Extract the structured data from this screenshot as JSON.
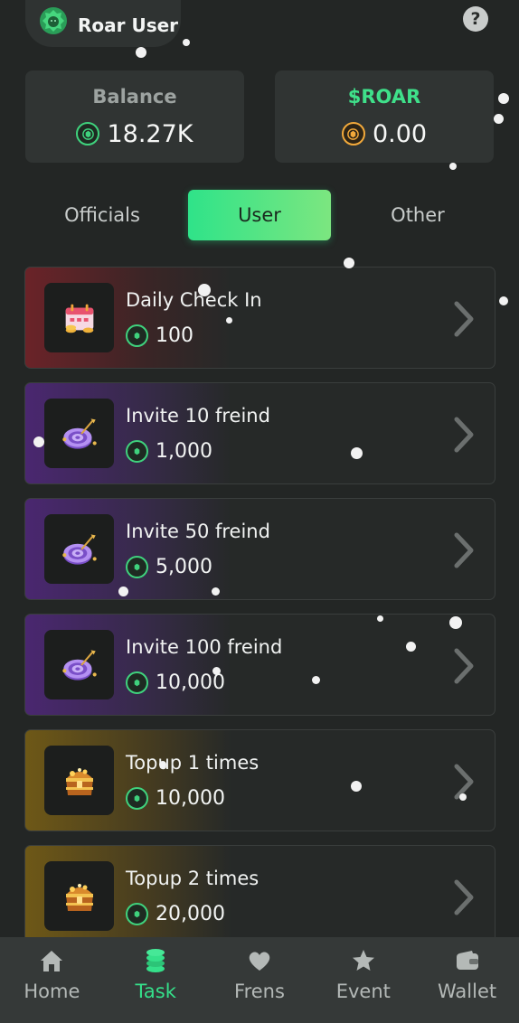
{
  "header": {
    "user_name": "Roar User",
    "help_label": "?"
  },
  "stats": {
    "balance": {
      "label": "Balance",
      "value": "18.27K"
    },
    "roar": {
      "label": "$ROAR",
      "value": "0.00"
    }
  },
  "tabs": [
    {
      "label": "Officials",
      "active": false
    },
    {
      "label": "User",
      "active": true
    },
    {
      "label": "Other",
      "active": false
    }
  ],
  "tasks": [
    {
      "title": "Daily Check In",
      "reward": "100",
      "icon": "calendar-gift-icon",
      "theme": "red"
    },
    {
      "title": "Invite 10 freind",
      "reward": "1,000",
      "icon": "target-darts-icon",
      "theme": "purple"
    },
    {
      "title": "Invite 50 freind",
      "reward": "5,000",
      "icon": "target-darts-icon",
      "theme": "purple"
    },
    {
      "title": "Invite 100 freind",
      "reward": "10,000",
      "icon": "target-darts-icon",
      "theme": "purple"
    },
    {
      "title": "Topup 1 times",
      "reward": "10,000",
      "icon": "treasure-chest-icon",
      "theme": "gold"
    },
    {
      "title": "Topup 2 times",
      "reward": "20,000",
      "icon": "treasure-chest-icon",
      "theme": "gold"
    }
  ],
  "nav": [
    {
      "label": "Home",
      "icon": "home-icon",
      "active": false
    },
    {
      "label": "Task",
      "icon": "coins-stack-icon",
      "active": true
    },
    {
      "label": "Frens",
      "icon": "heart-icon",
      "active": false
    },
    {
      "label": "Event",
      "icon": "star-icon",
      "active": false
    },
    {
      "label": "Wallet",
      "icon": "wallet-icon",
      "active": false
    }
  ],
  "colors": {
    "accent": "#35e08a",
    "background": "#232625",
    "card": "#303433",
    "gold": "#f2a93b"
  }
}
